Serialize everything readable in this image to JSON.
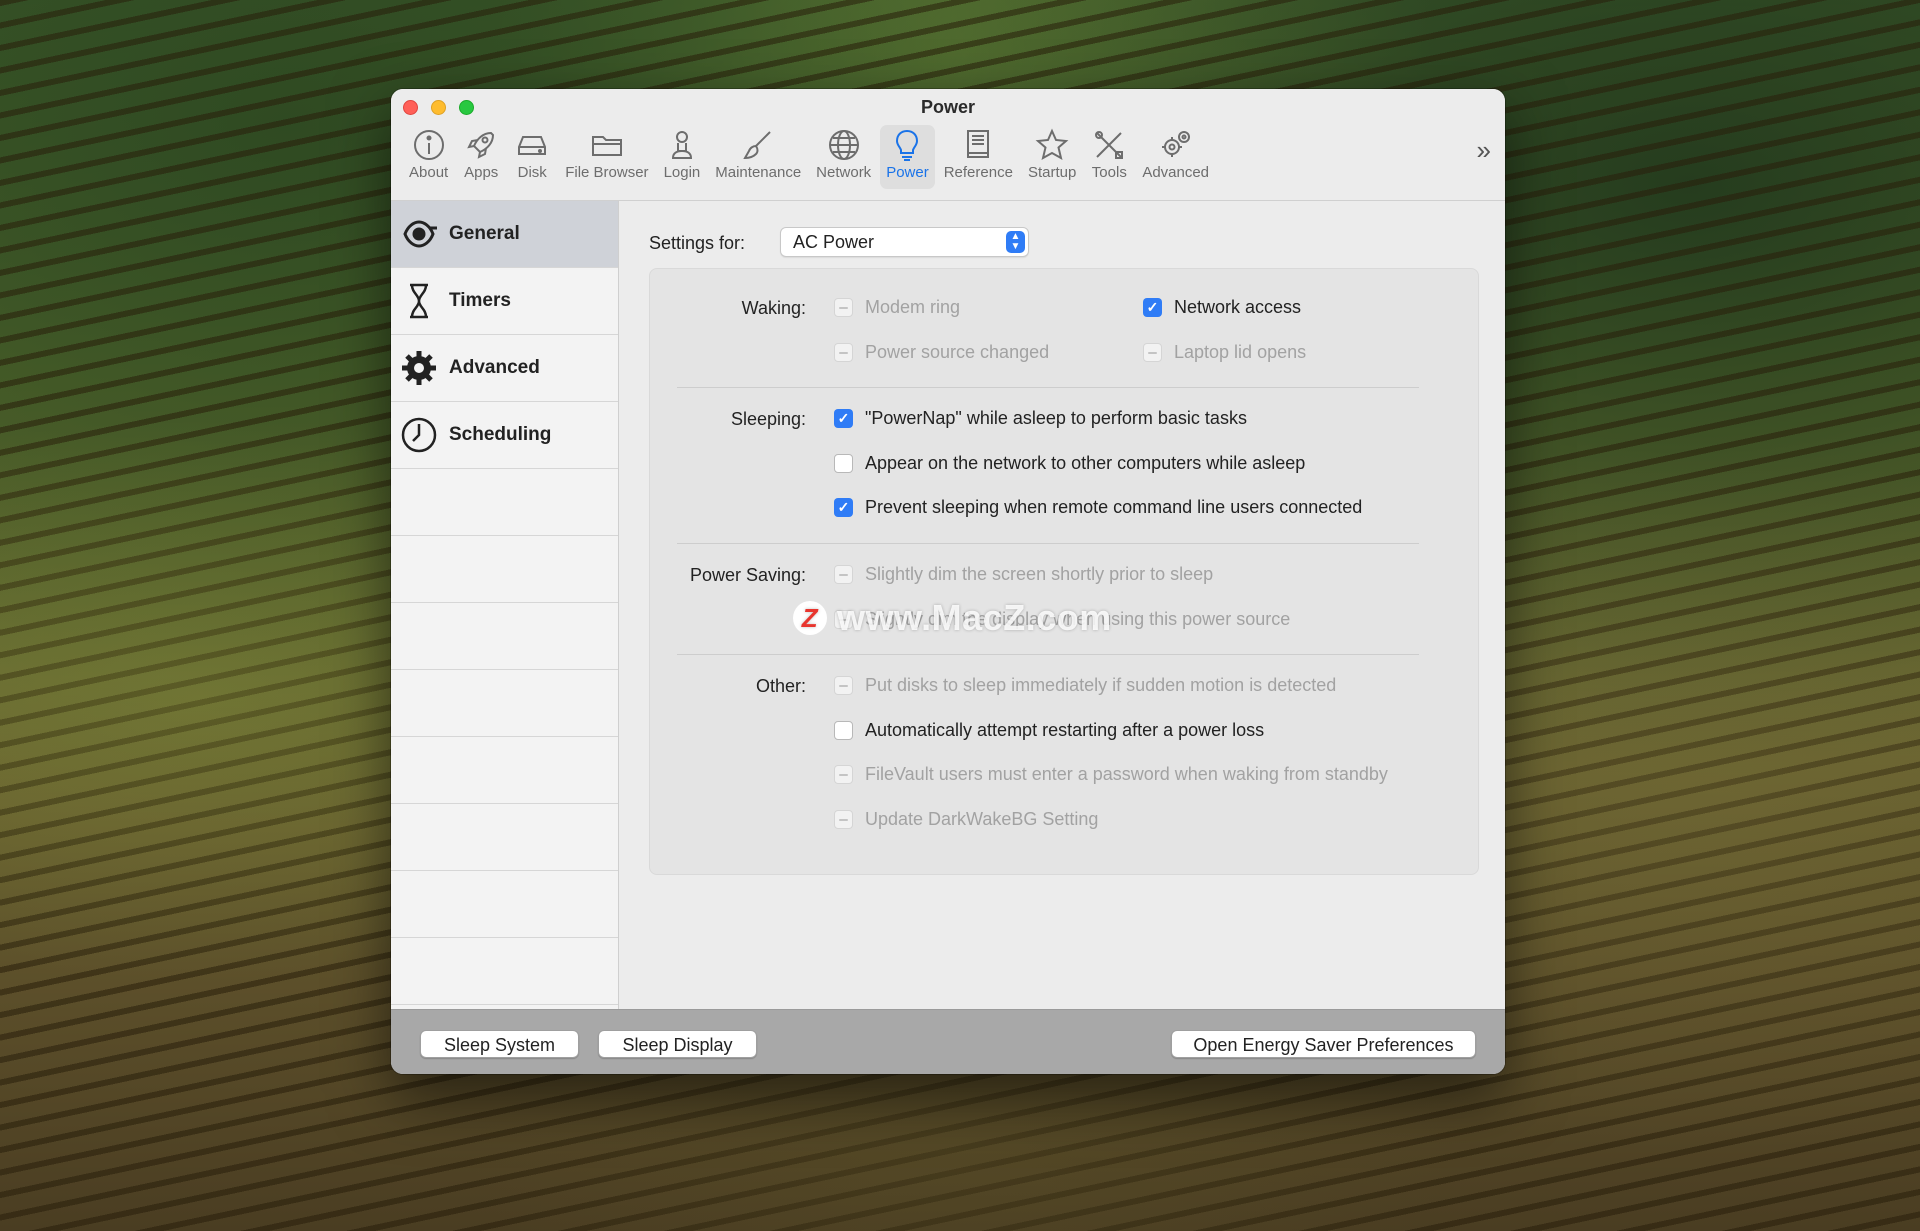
{
  "window": {
    "title": "Power"
  },
  "toolbar": {
    "items": [
      {
        "label": "About",
        "icon": "info-icon"
      },
      {
        "label": "Apps",
        "icon": "rocket-icon"
      },
      {
        "label": "Disk",
        "icon": "disk-icon"
      },
      {
        "label": "File Browser",
        "icon": "folder-icon"
      },
      {
        "label": "Login",
        "icon": "person-icon"
      },
      {
        "label": "Maintenance",
        "icon": "brush-icon"
      },
      {
        "label": "Network",
        "icon": "globe-icon"
      },
      {
        "label": "Power",
        "icon": "lightbulb-icon",
        "active": true
      },
      {
        "label": "Reference",
        "icon": "book-icon"
      },
      {
        "label": "Startup",
        "icon": "star-icon"
      },
      {
        "label": "Tools",
        "icon": "tools-icon"
      },
      {
        "label": "Advanced",
        "icon": "gears-icon"
      }
    ],
    "overflow_icon": "chevron-double-right-icon"
  },
  "sidebar": {
    "items": [
      {
        "label": "General",
        "icon": "general-icon",
        "active": true
      },
      {
        "label": "Timers",
        "icon": "hourglass-icon"
      },
      {
        "label": "Advanced",
        "icon": "gear-icon"
      },
      {
        "label": "Scheduling",
        "icon": "clock-icon"
      }
    ]
  },
  "settings": {
    "label": "Settings for:",
    "selected": "AC Power"
  },
  "sections": {
    "waking": {
      "label": "Waking:",
      "options": [
        {
          "label": "Modem ring",
          "state": "mixed",
          "disabled": true
        },
        {
          "label": "Network access",
          "state": "checked",
          "disabled": false
        },
        {
          "label": "Power source changed",
          "state": "mixed",
          "disabled": true
        },
        {
          "label": "Laptop lid opens",
          "state": "mixed",
          "disabled": true
        }
      ]
    },
    "sleeping": {
      "label": "Sleeping:",
      "options": [
        {
          "label": "\"PowerNap\" while asleep to perform basic tasks",
          "state": "checked",
          "disabled": false
        },
        {
          "label": "Appear on the network to other computers while asleep",
          "state": "unchecked",
          "disabled": false
        },
        {
          "label": "Prevent sleeping when remote command line users connected",
          "state": "checked",
          "disabled": false
        }
      ]
    },
    "power_saving": {
      "label": "Power Saving:",
      "options": [
        {
          "label": "Slightly dim the screen shortly prior to sleep",
          "state": "mixed",
          "disabled": true
        },
        {
          "label": "Slightly dim the display when using this power source",
          "state": "mixed",
          "disabled": true
        }
      ]
    },
    "other": {
      "label": "Other:",
      "options": [
        {
          "label": "Put disks to sleep immediately if sudden motion is detected",
          "state": "mixed",
          "disabled": true
        },
        {
          "label": "Automatically attempt restarting after a power loss",
          "state": "unchecked",
          "disabled": false
        },
        {
          "label": "FileVault users must enter a password when waking from standby",
          "state": "mixed",
          "disabled": true
        },
        {
          "label": "Update DarkWakeBG Setting",
          "state": "mixed",
          "disabled": true
        }
      ]
    }
  },
  "footer": {
    "sleep_system": "Sleep System",
    "sleep_display": "Sleep Display",
    "open_energy_saver": "Open Energy Saver Preferences"
  },
  "watermark": {
    "text": "www.MacZ.com",
    "logo": "Z"
  },
  "colors": {
    "accent": "#2f7cf6",
    "close": "#ff5f57",
    "minimize": "#febc2e",
    "maximize": "#28c840"
  }
}
